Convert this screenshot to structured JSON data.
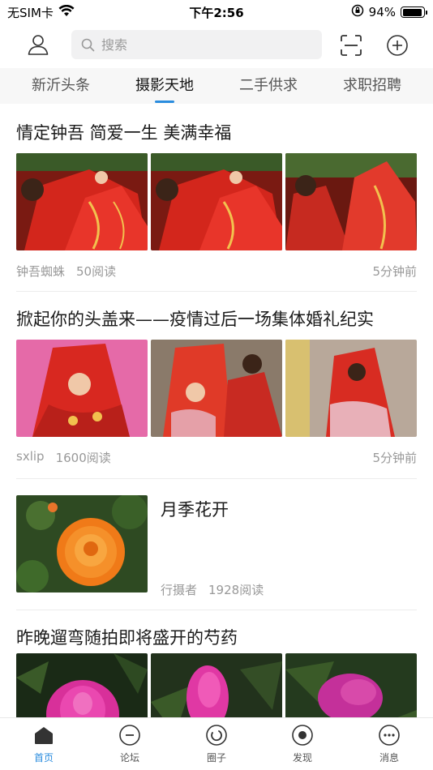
{
  "status_bar": {
    "carrier": "无SIM卡",
    "time": "下午2:56",
    "battery": "94%",
    "battery_level": 0.94
  },
  "header": {
    "search_placeholder": "搜索",
    "icons": [
      "user-icon",
      "search-icon",
      "scan-icon",
      "add-icon"
    ]
  },
  "tabs": [
    {
      "label": "新沂头条",
      "active": false
    },
    {
      "label": "摄影天地",
      "active": true
    },
    {
      "label": "二手供求",
      "active": false
    },
    {
      "label": "求职招聘",
      "active": false
    }
  ],
  "accent_color": "#2a8cde",
  "posts": [
    {
      "title": "情定钟吾  简爱一生  美满幸福",
      "author": "钟吾蜘蛛",
      "reads": "50阅读",
      "time": "5分钟前"
    },
    {
      "title": "掀起你的头盖来——疫情过后一场集体婚礼纪实",
      "author": "sxlip",
      "reads": "1600阅读",
      "time": "5分钟前"
    },
    {
      "title": "月季花开",
      "author": "行摄者",
      "reads": "1928阅读",
      "time": ""
    },
    {
      "title": "昨晚遛弯随拍即将盛开的芍药",
      "author": "",
      "reads": "",
      "time": ""
    }
  ],
  "bottom_nav": [
    {
      "label": "首页",
      "icon": "home-icon",
      "active": true
    },
    {
      "label": "论坛",
      "icon": "forum-icon",
      "active": false
    },
    {
      "label": "圈子",
      "icon": "circle-icon",
      "active": false
    },
    {
      "label": "发现",
      "icon": "discover-icon",
      "active": false
    },
    {
      "label": "消息",
      "icon": "message-icon",
      "active": false
    }
  ]
}
